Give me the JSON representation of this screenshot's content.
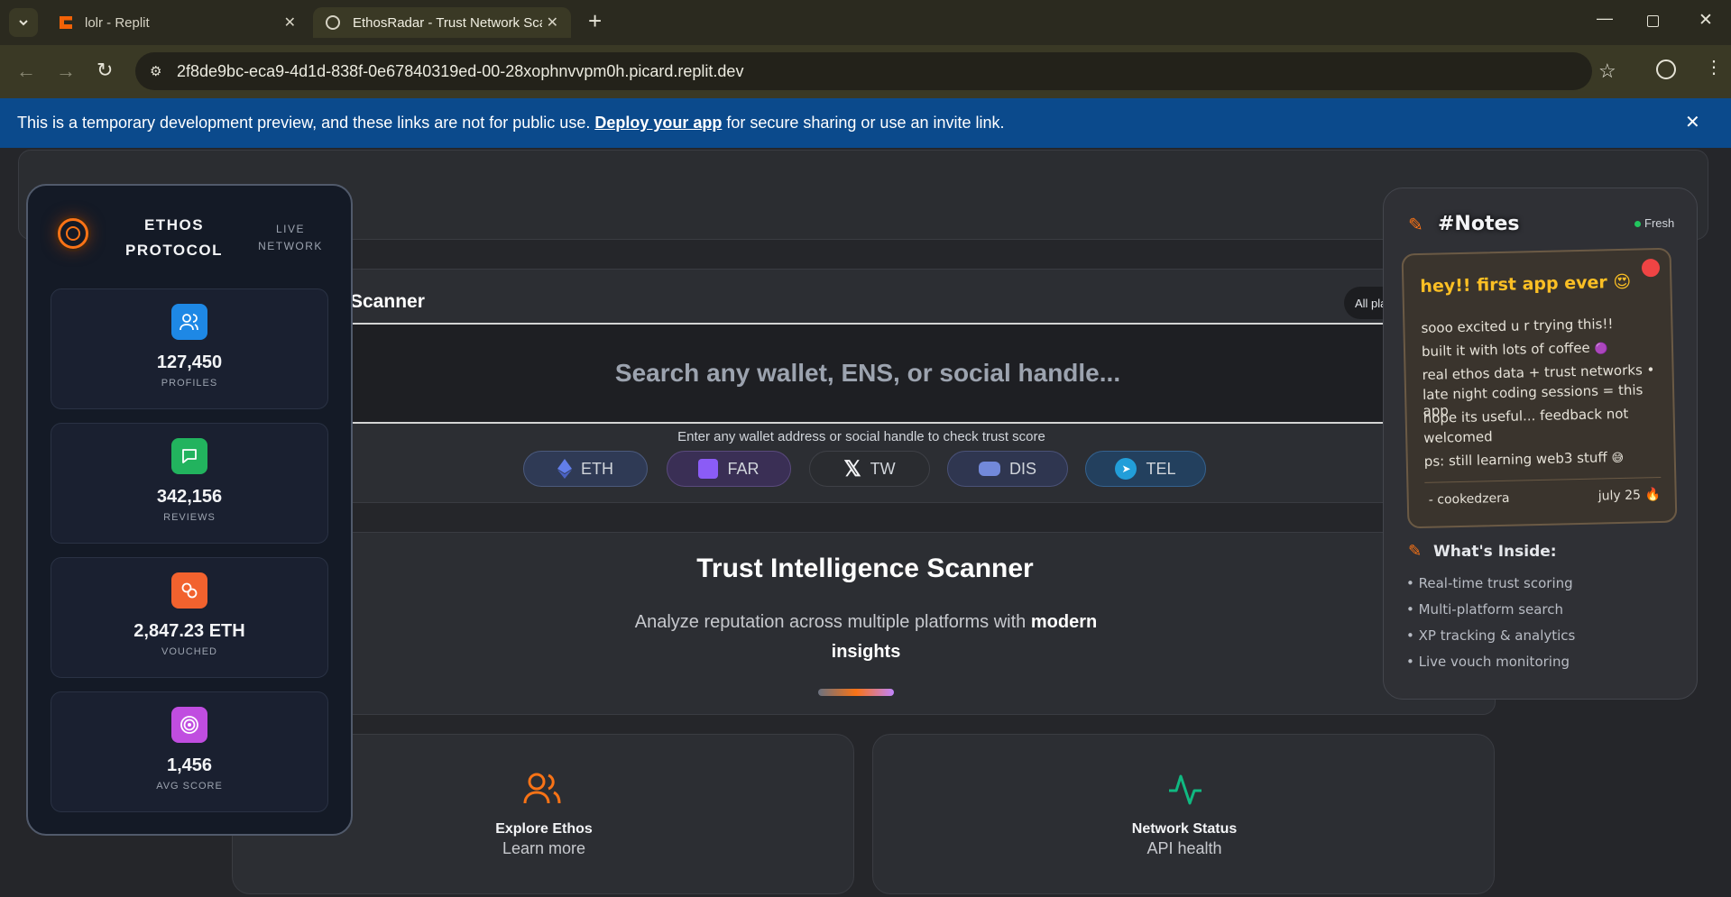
{
  "browser": {
    "tabs": [
      {
        "title": "lolr - Replit"
      },
      {
        "title": "EthosRadar - Trust Network Sca"
      }
    ],
    "url": "2f8de9bc-eca9-4d1d-838f-0e67840319ed-00-28xophnvvpm0h.picard.replit.dev"
  },
  "banner": {
    "text_before": "This is a temporary development preview, and these links are not for public use.",
    "link": "Deploy your app",
    "text_after": "for secure sharing or use an invite link."
  },
  "sidebar": {
    "brand_line1": "ETHOS",
    "brand_line2": "PROTOCOL",
    "live_line1": "LIVE",
    "live_line2": "NETWORK",
    "stats": [
      {
        "value": "127,450",
        "label": "PROFILES",
        "icon": "users-icon",
        "color": "#1e88e5"
      },
      {
        "value": "342,156",
        "label": "REVIEWS",
        "icon": "message-icon",
        "color": "#22b35e"
      },
      {
        "value": "2,847.23 ETH",
        "label": "VOUCHED",
        "icon": "link-icon",
        "color": "#f2622e"
      },
      {
        "value": "1,456",
        "label": "AVG SCORE",
        "icon": "target-icon",
        "color": "#c04de0"
      }
    ]
  },
  "scanner": {
    "header_title": "Scanner",
    "platform_filter": "All pla",
    "search_placeholder": "Search any wallet, ENS, or social handle...",
    "hint": "Enter any wallet address or social handle to check trust score",
    "chips": [
      {
        "label": "ETH",
        "icon": "ethereum-icon"
      },
      {
        "label": "FAR",
        "icon": "farcaster-icon"
      },
      {
        "label": "TW",
        "icon": "x-icon"
      },
      {
        "label": "DIS",
        "icon": "discord-icon"
      },
      {
        "label": "TEL",
        "icon": "telegram-icon"
      }
    ]
  },
  "hero": {
    "title": "Trust Intelligence Scanner",
    "subtitle_plain": "Analyze reputation across multiple platforms with",
    "subtitle_bold1": "modern",
    "subtitle_bold2": "insights"
  },
  "links": [
    {
      "title": "Explore Ethos",
      "sub": "Learn more",
      "icon": "users-icon",
      "color": "#f97316"
    },
    {
      "title": "Network Status",
      "sub": "API health",
      "icon": "activity-icon",
      "color": "#10b981"
    }
  ],
  "notes": {
    "title": "#Notes",
    "status": "Fresh",
    "heading": "hey!! first app ever",
    "lines": [
      "sooo excited u r trying this!!",
      "built it with lots of coffee",
      "real ethos data + trust networks •",
      "late night coding sessions = this app",
      "hope its useful... feedback not",
      "welcomed",
      "ps: still learning web3 stuff"
    ],
    "signature": "- cookedzera",
    "date": "july 25",
    "inside_title": "What's Inside:",
    "features": [
      "• Real-time trust scoring",
      "• Multi-platform search",
      "• XP tracking & analytics",
      "• Live vouch monitoring"
    ]
  }
}
